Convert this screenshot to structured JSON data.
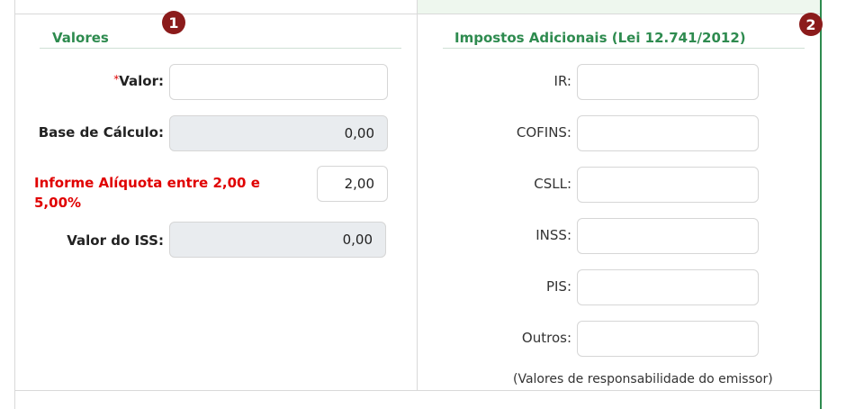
{
  "left_panel": {
    "title": "Valores",
    "badge": "1",
    "required_marker": "*",
    "valor_label": "Valor:",
    "valor_value": "",
    "base_label": "Base de Cálculo:",
    "base_value": "0,00",
    "warning_line1": "Informe Alíquota entre 2,00 e",
    "warning_line2": "5,00%",
    "aliquota_value": "2,00",
    "iss_label": "Valor do ISS:",
    "iss_value": "0,00"
  },
  "right_panel": {
    "title": "Impostos Adicionais (Lei 12.741/2012)",
    "badge": "2",
    "fields": [
      {
        "label": "IR:",
        "value": ""
      },
      {
        "label": "COFINS:",
        "value": ""
      },
      {
        "label": "CSLL:",
        "value": ""
      },
      {
        "label": "INSS:",
        "value": ""
      },
      {
        "label": "PIS:",
        "value": ""
      },
      {
        "label": "Outros:",
        "value": ""
      }
    ],
    "note": "(Valores de responsabilidade do emissor)"
  },
  "colors": {
    "accent_green": "#2e8b4f",
    "warning_red": "#e00000",
    "badge_red": "#8b1b1b",
    "readonly_bg": "#e9ecef"
  }
}
